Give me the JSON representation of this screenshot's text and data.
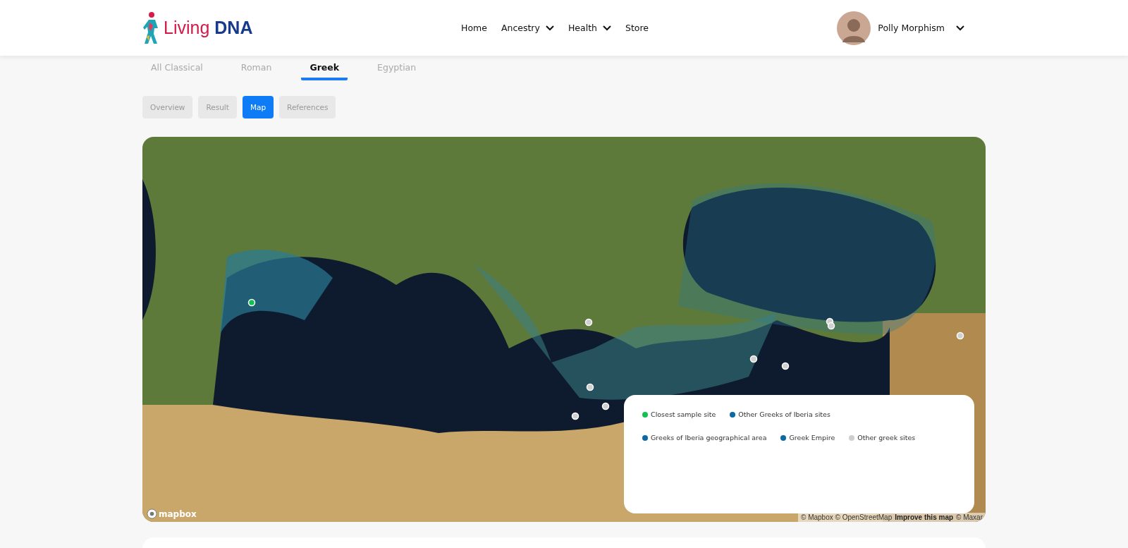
{
  "header": {
    "logo": {
      "part_1": "Living",
      "part_2": "DNA"
    },
    "nav": [
      {
        "label": "Home",
        "dropdown": false
      },
      {
        "label": "Ancestry",
        "dropdown": true
      },
      {
        "label": "Health",
        "dropdown": true
      },
      {
        "label": "Store",
        "dropdown": false
      }
    ],
    "user": {
      "name": "Polly Morphism"
    }
  },
  "tabs": [
    {
      "label": "All Classical",
      "selected": false
    },
    {
      "label": "Roman",
      "selected": false
    },
    {
      "label": "Greek",
      "selected": true
    },
    {
      "label": "Egyptian",
      "selected": false
    }
  ],
  "subtabs": [
    {
      "label": "Overview",
      "selected": false
    },
    {
      "label": "Result",
      "selected": false
    },
    {
      "label": "Map",
      "selected": true
    },
    {
      "label": "References",
      "selected": false
    }
  ],
  "map": {
    "logo": "mapbox",
    "legend": [
      [
        {
          "label": "Closest sample site",
          "color": "#12c150"
        },
        {
          "label": "Other Greeks of Iberia sites",
          "color": "#0b6aa2"
        }
      ],
      [
        {
          "label": "Greeks of Iberia geographical area",
          "color": "#0b6aa2"
        },
        {
          "label": "Greek Empire",
          "color": "#0b6aa2"
        },
        {
          "label": "Other greek sites",
          "color": "#cfcfcf"
        }
      ]
    ],
    "attribution": {
      "text": "© Mapbox © OpenStreetMap",
      "link": "Improve this map",
      "suffix": "© Maxar"
    }
  }
}
